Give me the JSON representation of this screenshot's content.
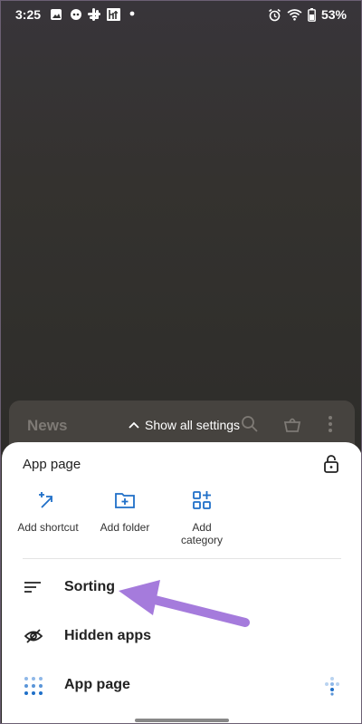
{
  "status_bar": {
    "time": "3:25",
    "battery": "53%"
  },
  "drawer": {
    "news_label": "News",
    "show_all_label": "Show all settings"
  },
  "sheet": {
    "title": "App page",
    "quick_actions": [
      {
        "label": "Add shortcut",
        "icon": "add-shortcut-icon"
      },
      {
        "label": "Add folder",
        "icon": "add-folder-icon"
      },
      {
        "label": "Add category",
        "icon": "add-category-icon"
      }
    ],
    "rows": [
      {
        "label": "Sorting",
        "icon": "sort-icon"
      },
      {
        "label": "Hidden apps",
        "icon": "eye-off-icon"
      },
      {
        "label": "App page",
        "icon": "grid-dots-icon"
      }
    ]
  },
  "colors": {
    "accent_blue": "#1f6fc8",
    "arrow_purple": "#a57bdc"
  }
}
